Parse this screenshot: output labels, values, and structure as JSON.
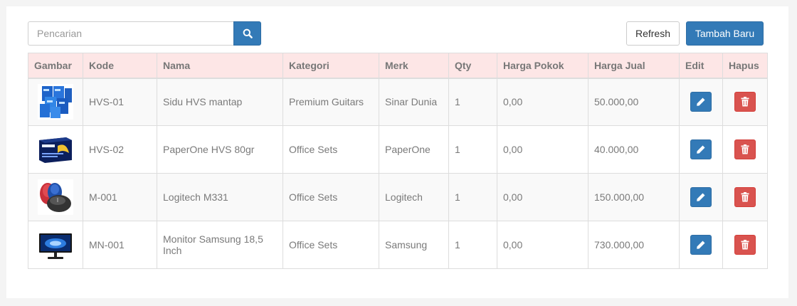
{
  "toolbar": {
    "search_placeholder": "Pencarian",
    "search_value": "",
    "refresh_label": "Refresh",
    "add_label": "Tambah Baru",
    "search_icon": "search-icon"
  },
  "table": {
    "headers": {
      "gambar": "Gambar",
      "kode": "Kode",
      "nama": "Nama",
      "kategori": "Kategori",
      "merk": "Merk",
      "qty": "Qty",
      "harga_pokok": "Harga Pokok",
      "harga_jual": "Harga Jual",
      "edit": "Edit",
      "hapus": "Hapus"
    },
    "rows": [
      {
        "image": "paper-ream-stack-image",
        "kode": "HVS-01",
        "nama": "Sidu HVS mantap",
        "kategori": "Premium Guitars",
        "merk": "Sinar Dunia",
        "qty": "1",
        "harga_pokok": "0,00",
        "harga_jual": "50.000,00"
      },
      {
        "image": "paperone-box-image",
        "kode": "HVS-02",
        "nama": "PaperOne HVS 80gr",
        "kategori": "Office Sets",
        "merk": "PaperOne",
        "qty": "1",
        "harga_pokok": "0,00",
        "harga_jual": "40.000,00"
      },
      {
        "image": "logitech-mouse-image",
        "kode": "M-001",
        "nama": "Logitech M331",
        "kategori": "Office Sets",
        "merk": "Logitech",
        "qty": "1",
        "harga_pokok": "0,00",
        "harga_jual": "150.000,00"
      },
      {
        "image": "samsung-monitor-image",
        "kode": "MN-001",
        "nama": "Monitor Samsung 18,5 Inch",
        "kategori": "Office Sets",
        "merk": "Samsung",
        "qty": "1",
        "harga_pokok": "0,00",
        "harga_jual": "730.000,00"
      }
    ],
    "edit_icon": "pencil-icon",
    "delete_icon": "trash-icon"
  },
  "colors": {
    "primary": "#337ab7",
    "danger": "#d9534f",
    "header_bg": "#fde6e6"
  }
}
